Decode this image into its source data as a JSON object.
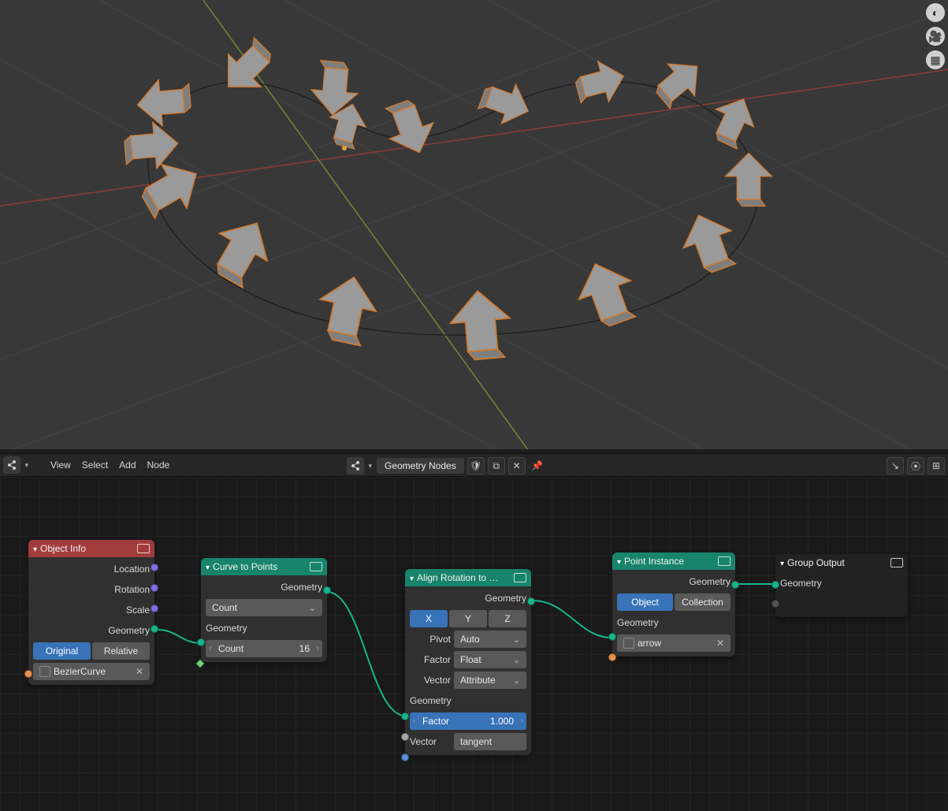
{
  "header": {
    "menus": {
      "view": "View",
      "select": "Select",
      "add": "Add",
      "node": "Node"
    },
    "modifier_name": "Geometry Nodes",
    "right_buttons": [
      "↘",
      "⦿",
      "⊞"
    ]
  },
  "nodes": {
    "object_info": {
      "title": "Object Info",
      "outputs": {
        "location": "Location",
        "rotation": "Rotation",
        "scale": "Scale",
        "geometry": "Geometry"
      },
      "buttons": {
        "original": "Original",
        "relative": "Relative"
      },
      "object_field": "BezierCurve"
    },
    "curve_to_points": {
      "title": "Curve to Points",
      "outputs": {
        "geometry": "Geometry"
      },
      "mode": "Count",
      "inputs": {
        "geometry": "Geometry"
      },
      "count_label": "Count",
      "count_val": "16"
    },
    "align_rotation": {
      "title": "Align Rotation to …",
      "outputs": {
        "geometry": "Geometry"
      },
      "axes": {
        "x": "X",
        "y": "Y",
        "z": "Z"
      },
      "pivot_label": "Pivot",
      "pivot_val": "Auto",
      "factor_label": "Factor",
      "factor_mode": "Float",
      "vector_label": "Vector",
      "vector_mode": "Attribute",
      "inputs": {
        "geometry": "Geometry"
      },
      "factor_num_label": "Factor",
      "factor_num_val": "1.000",
      "vector_in_label": "Vector",
      "vector_in_val": "tangent"
    },
    "point_instance": {
      "title": "Point Instance",
      "outputs": {
        "geometry": "Geometry"
      },
      "buttons": {
        "object": "Object",
        "collection": "Collection"
      },
      "inputs": {
        "geometry": "Geometry"
      },
      "object_field": "arrow"
    },
    "group_output": {
      "title": "Group Output",
      "inputs": {
        "geometry": "Geometry"
      }
    }
  }
}
